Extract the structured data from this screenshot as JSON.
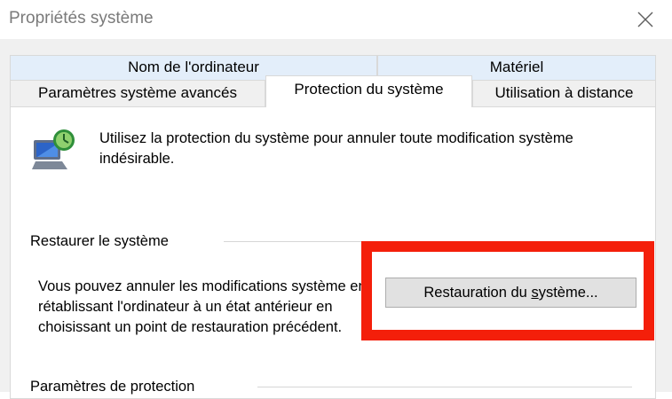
{
  "window": {
    "title": "Propriétés système",
    "close_glyph": "×"
  },
  "tabs": {
    "back": [
      "Nom de l'ordinateur",
      "Matériel"
    ],
    "front": [
      "Paramètres système avancés",
      "Protection du système",
      "Utilisation à distance"
    ],
    "active": "Protection du système"
  },
  "panel": {
    "intro_text": "Utilisez la protection du système pour annuler toute modification système indésirable.",
    "intro_icon": "system-protection-computer-icon",
    "restore_group": {
      "label": "Restaurer le système",
      "description": "Vous pouvez annuler les modifications système en rétablissant l'ordinateur à un état antérieur en choisissant un point de restauration précédent.",
      "button_label_pre": "Restauration du ",
      "button_label_accel": "s",
      "button_label_post": "ystème..."
    },
    "protection_group": {
      "label": "Paramètres de protection"
    }
  },
  "colors": {
    "highlight": "#f41f0a",
    "active_tab": "#ffffff",
    "back_tab": "#e3eefa",
    "dialog_bg": "#f0f0f0"
  }
}
